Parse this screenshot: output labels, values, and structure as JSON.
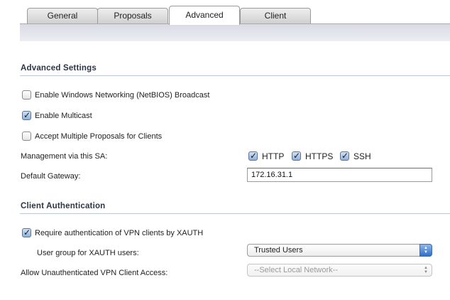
{
  "tabs": [
    {
      "label": "General"
    },
    {
      "label": "Proposals"
    },
    {
      "label": "Advanced"
    },
    {
      "label": "Client"
    }
  ],
  "active_tab": "Advanced",
  "advanced_settings": {
    "title": "Advanced Settings",
    "netbios": {
      "label": "Enable Windows Networking (NetBIOS) Broadcast",
      "checked": false
    },
    "multicast": {
      "label": "Enable Multicast",
      "checked": true
    },
    "multiple_proposals": {
      "label": "Accept Multiple Proposals for Clients",
      "checked": false
    },
    "management": {
      "label": "Management via this SA:",
      "http": {
        "label": "HTTP",
        "checked": true
      },
      "https": {
        "label": "HTTPS",
        "checked": true
      },
      "ssh": {
        "label": "SSH",
        "checked": true
      }
    },
    "default_gateway": {
      "label": "Default Gateway:",
      "value": "172.16.31.1"
    }
  },
  "client_authentication": {
    "title": "Client Authentication",
    "require_xauth": {
      "label": "Require authentication of VPN clients by XAUTH",
      "checked": true
    },
    "user_group": {
      "label": "User group for XAUTH users:",
      "selected": "Trusted Users"
    },
    "unauth_access": {
      "label": "Allow Unauthenticated VPN Client Access:",
      "selected": "--Select Local Network--"
    }
  },
  "icons": {
    "checkmark": "checkmark-icon",
    "select_arrows": "updown-arrows-icon"
  }
}
